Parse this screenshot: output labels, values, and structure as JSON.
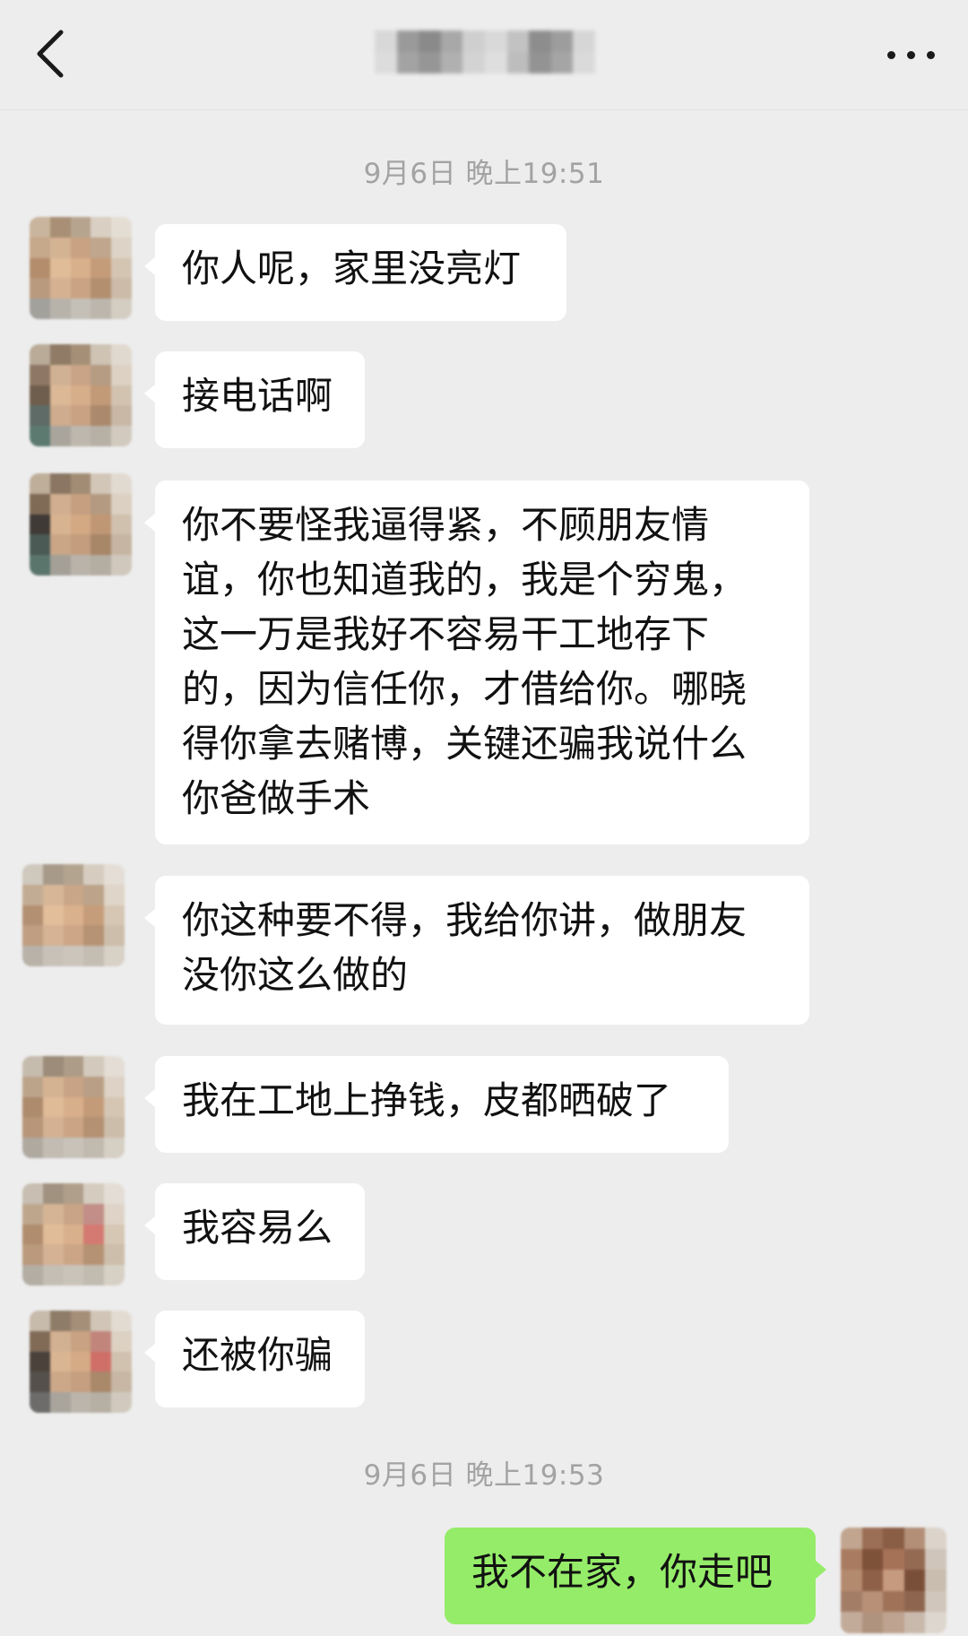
{
  "header": {
    "back_icon": "chevron-left-icon",
    "title": "",
    "more_icon": "more-horizontal-icon"
  },
  "timestamps": [
    "9月6日 晚上19:51",
    "9月6日 晚上19:53"
  ],
  "messages": [
    {
      "side": "left",
      "text": "你人呢，家里没亮灯"
    },
    {
      "side": "left",
      "text": "接电话啊"
    },
    {
      "side": "left",
      "text": "你不要怪我逼得紧，不顾朋友情谊，你也知道我的，我是个穷鬼，这一万是我好不容易干工地存下的，因为信任你，才借给你。哪晓得你拿去赌博，关键还骗我说什么你爸做手术"
    },
    {
      "side": "left",
      "text": "你这种要不得，我给你讲，做朋友没你这么做的"
    },
    {
      "side": "left",
      "text": "我在工地上挣钱，皮都晒破了"
    },
    {
      "side": "left",
      "text": "我容易么"
    },
    {
      "side": "left",
      "text": "还被你骗"
    },
    {
      "side": "right",
      "text": "我不在家，你走吧"
    }
  ],
  "colors": {
    "background": "#ededed",
    "bubble_incoming": "#ffffff",
    "bubble_outgoing": "#95ec69",
    "timestamp_text": "#a3a3a3"
  }
}
